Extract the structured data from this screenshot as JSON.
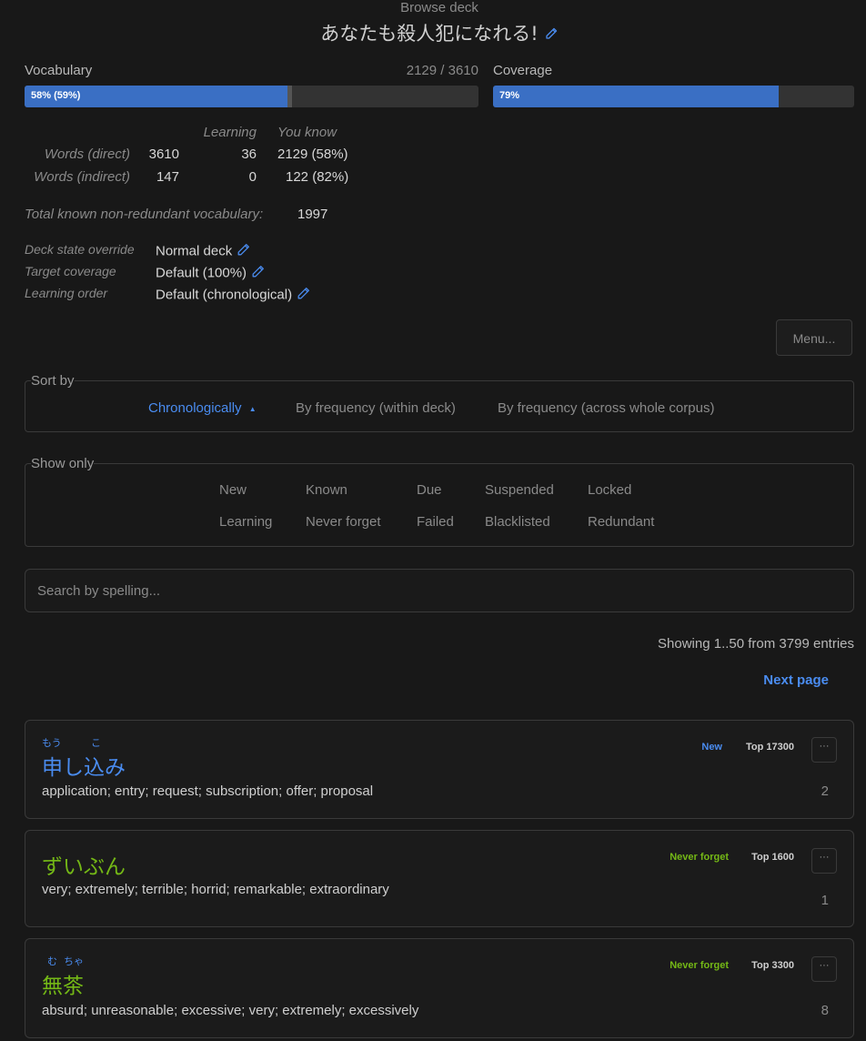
{
  "header": {
    "label": "Browse deck",
    "deck_title": "あなたも殺人犯になれる!"
  },
  "vocabulary": {
    "label": "Vocabulary",
    "count": "2129 / 3610",
    "bar_text": "58% (59%)",
    "fill_fraction": 0.58,
    "marker_fraction": 0.59
  },
  "coverage": {
    "label": "Coverage",
    "bar_text": "79%",
    "fill_fraction": 0.79
  },
  "stats": {
    "col_learning": "Learning",
    "col_you_know": "You know",
    "rows": [
      {
        "label": "Words (direct)",
        "total": "3610",
        "learning": "36",
        "known": "2129 (58%)"
      },
      {
        "label": "Words (indirect)",
        "total": "147",
        "learning": "0",
        "known": "122 (82%)"
      }
    ],
    "nonredundant_label": "Total known non-redundant vocabulary:",
    "nonredundant_value": "1997"
  },
  "settings": [
    {
      "label": "Deck state override",
      "value": "Normal deck"
    },
    {
      "label": "Target coverage",
      "value": "Default (100%)"
    },
    {
      "label": "Learning order",
      "value": "Default (chronological)"
    }
  ],
  "menu_label": "Menu...",
  "sort": {
    "legend": "Sort by",
    "options": [
      "Chronologically",
      "By frequency (within deck)",
      "By frequency (across whole corpus)"
    ],
    "active_arrow": "▲"
  },
  "filters": {
    "legend": "Show only",
    "row1": [
      "New",
      "Known",
      "Due",
      "Suspended",
      "Locked"
    ],
    "row2": [
      "Learning",
      "Never forget",
      "Failed",
      "Blacklisted",
      "Redundant"
    ]
  },
  "search": {
    "placeholder": "Search by spelling..."
  },
  "pagination": {
    "showing": "Showing 1..50 from 3799 entries",
    "next": "Next page"
  },
  "entries": [
    {
      "furigana": [
        "もう",
        "こ"
      ],
      "word": "申し込み",
      "meaning": "application; entry; request; subscription; offer; proposal",
      "status": "New",
      "rank": "Top 17300",
      "count": "2",
      "menu": "···"
    },
    {
      "furigana": [],
      "word": "ずいぶん",
      "meaning": "very; extremely; terrible; horrid; remarkable; extraordinary",
      "status": "Never forget",
      "rank": "Top 1600",
      "count": "1",
      "menu": "···"
    },
    {
      "furigana": [
        "む",
        "ちゃ"
      ],
      "word": "無茶",
      "meaning": "absurd; unreasonable; excessive; very; extremely; excessively",
      "status": "Never forget",
      "rank": "Top 3300",
      "count": "8",
      "menu": "···"
    }
  ],
  "colors": {
    "accent_blue": "#4a8cf0",
    "never_forget_green": "#74b816",
    "bar_fill": "#3a6fc4",
    "background": "#181818"
  }
}
